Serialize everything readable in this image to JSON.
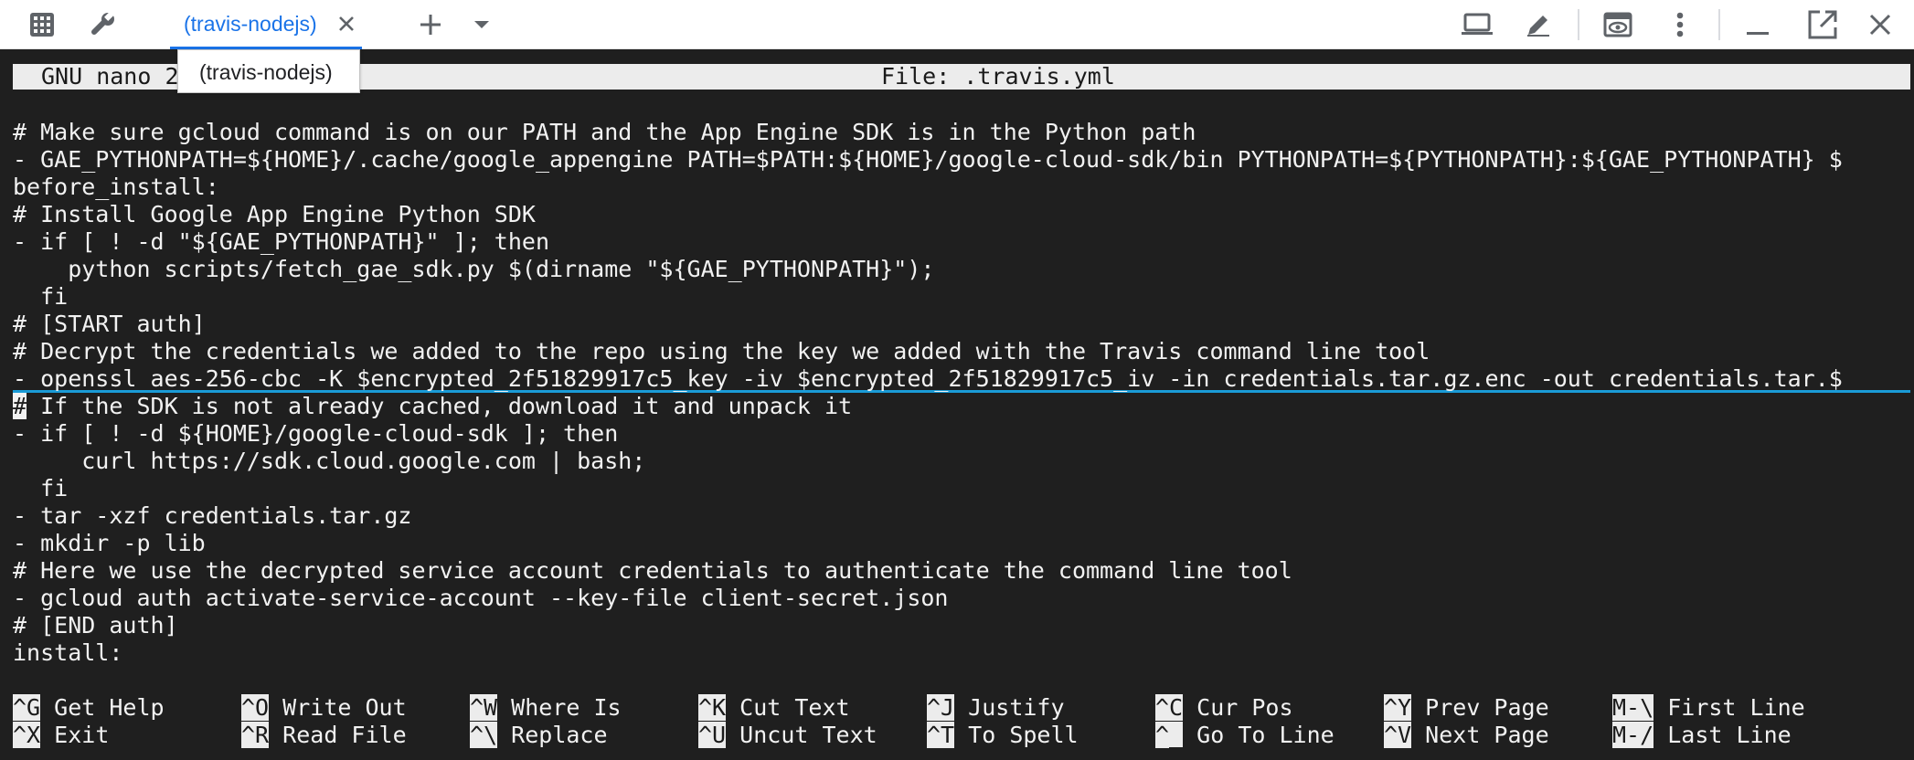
{
  "tab": {
    "label": "(travis-nodejs)"
  },
  "tooltip": {
    "text": "(travis-nodejs)"
  },
  "nano": {
    "version_label": "GNU nano 2",
    "file_label": "File: .travis.yml"
  },
  "editor": {
    "lines": [
      "# Make sure gcloud command is on our PATH and the App Engine SDK is in the Python path",
      "- GAE_PYTHONPATH=${HOME}/.cache/google_appengine PATH=$PATH:${HOME}/google-cloud-sdk/bin PYTHONPATH=${PYTHONPATH}:${GAE_PYTHONPATH} $",
      "before_install:",
      "# Install Google App Engine Python SDK",
      "- if [ ! -d \"${GAE_PYTHONPATH}\" ]; then",
      "    python scripts/fetch_gae_sdk.py $(dirname \"${GAE_PYTHONPATH}\");",
      "  fi",
      "# [START auth]",
      "# Decrypt the credentials we added to the repo using the key we added with the Travis command line tool",
      "- openssl aes-256-cbc -K $encrypted_2f51829917c5_key -iv $encrypted_2f51829917c5_iv -in credentials.tar.gz.enc -out credentials.tar.$",
      "# If the SDK is not already cached, download it and unpack it",
      "- if [ ! -d ${HOME}/google-cloud-sdk ]; then",
      "     curl https://sdk.cloud.google.com | bash;",
      "  fi",
      "- tar -xzf credentials.tar.gz",
      "- mkdir -p lib",
      "# Here we use the decrypted service account credentials to authenticate the command line tool",
      "- gcloud auth activate-service-account --key-file client-secret.json",
      "# [END auth]",
      "install:"
    ],
    "cursor_char": "#",
    "cursor_rest": " If the SDK is not already cached, download it and unpack it"
  },
  "shortcuts": [
    {
      "key": "^G",
      "label": "Get Help"
    },
    {
      "key": "^X",
      "label": "Exit"
    },
    {
      "key": "^O",
      "label": "Write Out"
    },
    {
      "key": "^R",
      "label": "Read File"
    },
    {
      "key": "^W",
      "label": "Where Is"
    },
    {
      "key": "^\\",
      "label": "Replace"
    },
    {
      "key": "^K",
      "label": "Cut Text"
    },
    {
      "key": "^U",
      "label": "Uncut Text"
    },
    {
      "key": "^J",
      "label": "Justify"
    },
    {
      "key": "^T",
      "label": "To Spell"
    },
    {
      "key": "^C",
      "label": "Cur Pos"
    },
    {
      "key": "^_",
      "label": "Go To Line"
    },
    {
      "key": "^Y",
      "label": "Prev Page"
    },
    {
      "key": "^V",
      "label": "Next Page"
    },
    {
      "key": "M-\\",
      "label": "First Line"
    },
    {
      "key": "M-/",
      "label": "Last Line"
    }
  ],
  "icons": {
    "apps": "apps-grid-icon",
    "settings": "wrench-icon",
    "close_tab": "close-icon",
    "new_tab": "plus-icon",
    "tab_menu": "dropdown-arrow-icon",
    "laptop": "laptop-icon",
    "edit": "pencil-icon",
    "preview": "preview-eye-icon",
    "more": "more-vert-icon",
    "minimize": "minimize-icon",
    "popout": "open-in-new-icon",
    "close": "close-window-icon"
  },
  "colors": {
    "accent": "#1a73e8",
    "terminal_bg": "#1f1f1f",
    "terminal_fg": "#f2f2f2",
    "highlight_underline": "#1a9bd7"
  }
}
